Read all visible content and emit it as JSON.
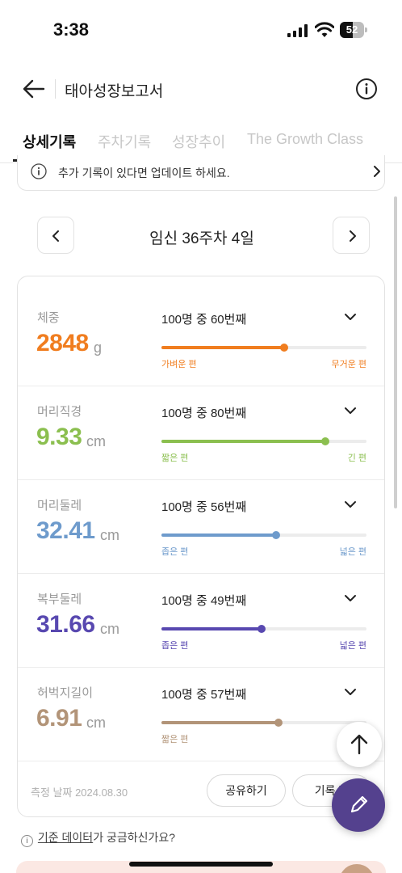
{
  "status_bar": {
    "time": "3:38",
    "battery": "52",
    "battery_level": 0.52,
    "icons": [
      "signal-icon",
      "wifi-icon",
      "battery-icon"
    ]
  },
  "header": {
    "title": "태아성장보고서",
    "back_icon": "arrow-left-icon",
    "info_icon": "info-icon"
  },
  "tabs": [
    {
      "label": "상세기록",
      "active": true
    },
    {
      "label": "주차기록",
      "active": false
    },
    {
      "label": "성장추이",
      "active": false
    },
    {
      "label": "The Growth Class",
      "active": false
    }
  ],
  "notice": {
    "text": "추가 기록이 있다면 업데이트 하세요.",
    "icon": "info-icon"
  },
  "week": {
    "label": "임신 36주차 4일"
  },
  "metrics": [
    {
      "label": "체중",
      "value": "2848",
      "unit": "g",
      "rank": "100명 중 60번째",
      "low": "가벼운 편",
      "high": "무거운 편",
      "percentile": 0.6,
      "color": "#f07d1f"
    },
    {
      "label": "머리직경",
      "value": "9.33",
      "unit": "cm",
      "rank": "100명 중 80번째",
      "low": "짧은 편",
      "high": "긴 편",
      "percentile": 0.8,
      "color": "#8bbf4f"
    },
    {
      "label": "머리둘레",
      "value": "32.41",
      "unit": "cm",
      "rank": "100명 중 56번째",
      "low": "좁은 편",
      "high": "넓은 편",
      "percentile": 0.56,
      "color": "#6e9bcc"
    },
    {
      "label": "복부둘레",
      "value": "31.66",
      "unit": "cm",
      "rank": "100명 중 49번째",
      "low": "좁은 편",
      "high": "넓은 편",
      "percentile": 0.49,
      "color": "#5848b0"
    },
    {
      "label": "허벅지길이",
      "value": "6.91",
      "unit": "cm",
      "rank": "100명 중 57번째",
      "low": "짧은 편",
      "high": "",
      "percentile": 0.57,
      "color": "#b29478"
    }
  ],
  "footer": {
    "date": "측정 날짜 2024.08.30",
    "share_label": "공유하기",
    "record_label": "기록 편"
  },
  "faq": {
    "icon_glyph": "i",
    "link_text": "기준 데이터",
    "rest_text": "가 궁금하신가요?"
  },
  "fab": {
    "up_icon": "arrow-up-icon",
    "edit_icon": "pencil-icon"
  }
}
